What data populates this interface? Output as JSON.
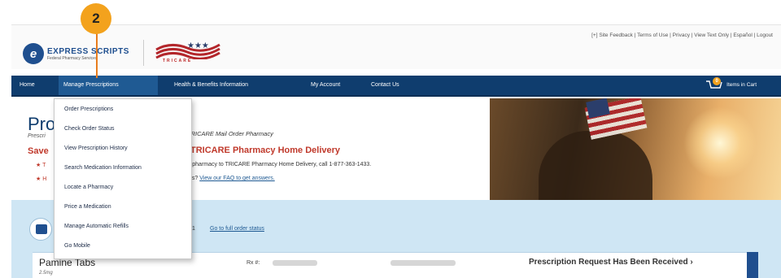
{
  "callout": {
    "number": "2",
    "color": "#f3a21d"
  },
  "header": {
    "logo_main": "EXPRESS SCRIPTS",
    "logo_sub": "Federal Pharmacy Services",
    "tricare_word": "TRICARE",
    "utility_links": "[+] Site Feedback  |  Terms of Use  |  Privacy  |  View Text Only  |  Español  |  Logout"
  },
  "nav": {
    "items": [
      "Home",
      "Manage Prescriptions",
      "Health & Benefits Information",
      "My Account",
      "Contact Us"
    ],
    "cart_count": "0",
    "cart_label": "Items in Cart",
    "bar_color": "#0f3d6e"
  },
  "dropdown": {
    "items": [
      "Order Prescriptions",
      "Check Order Status",
      "View Prescription History",
      "Search Medication Information",
      "Locate a Pharmacy",
      "Price a Medication",
      "Manage Automatic Refills",
      "Go Mobile"
    ]
  },
  "hero": {
    "title": "Prod",
    "subtitle": "Prescri",
    "save_label": "Save",
    "bullet_1": "★ T",
    "bullet_2": "★ H",
    "mail_order": "TRICARE Mail Order Pharmacy",
    "home_delivery": "TRICARE Pharmacy Home Delivery",
    "switch_text": "r pharmacy to TRICARE Pharmacy Home Delivery, call 1-877-363-1433.",
    "faq_prefix": "ns?",
    "faq_link": "View our FAQ to get answers."
  },
  "orders": {
    "count": "1",
    "link": "Go to full order status"
  },
  "rx": {
    "name": "Pamine Tabs",
    "dose": "2.5mg",
    "rx_label": "Rx #:",
    "status": "Prescription Request Has Been Received ›"
  }
}
